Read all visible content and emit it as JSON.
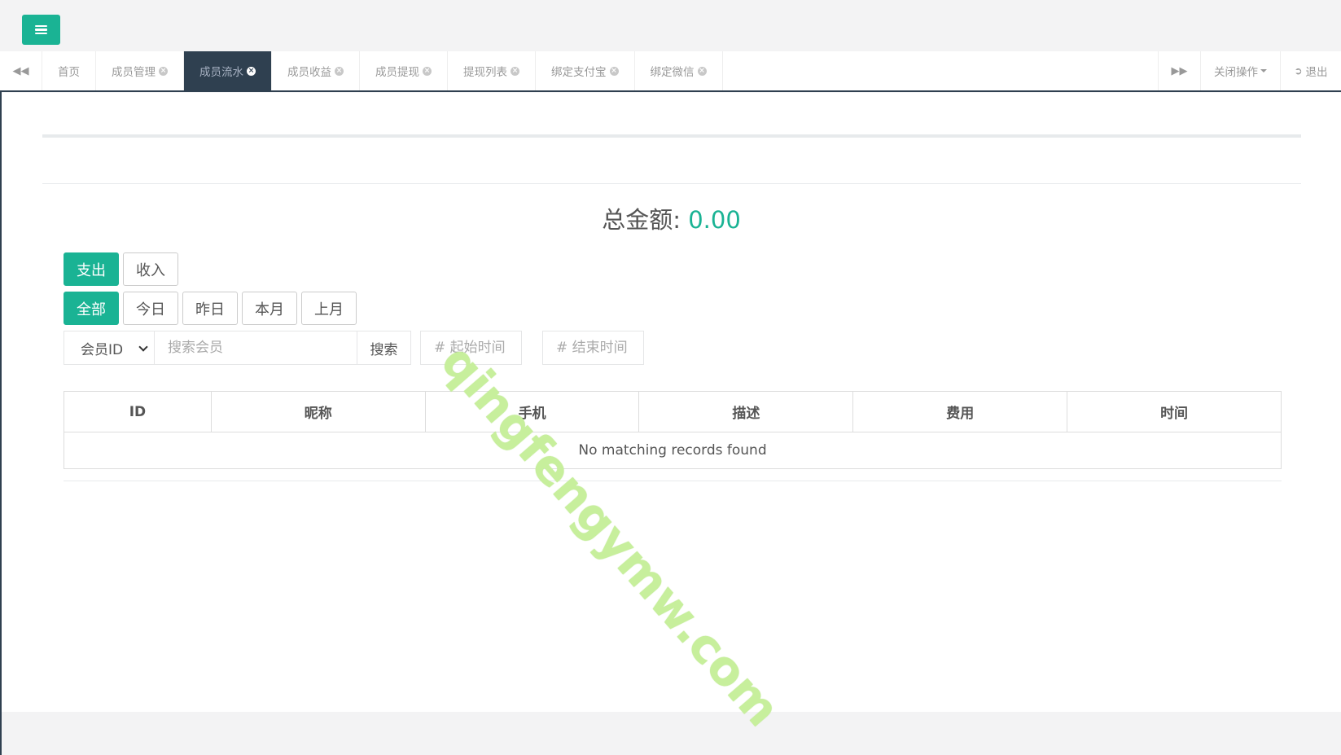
{
  "tabbar": {
    "tabs": [
      {
        "label": "首页",
        "closable": false,
        "active": false
      },
      {
        "label": "成员管理",
        "closable": true,
        "active": false
      },
      {
        "label": "成员流水",
        "closable": true,
        "active": true
      },
      {
        "label": "成员收益",
        "closable": true,
        "active": false
      },
      {
        "label": "成员提现",
        "closable": true,
        "active": false
      },
      {
        "label": "提现列表",
        "closable": true,
        "active": false
      },
      {
        "label": "绑定支付宝",
        "closable": true,
        "active": false
      },
      {
        "label": "绑定微信",
        "closable": true,
        "active": false
      }
    ],
    "close_ops_label": "关闭操作",
    "logout_label": "退出"
  },
  "summary": {
    "total_label": "总金额:",
    "total_value": "0.00"
  },
  "type_filter": {
    "options": [
      "支出",
      "收入"
    ],
    "active": "支出"
  },
  "period_filter": {
    "options": [
      "全部",
      "今日",
      "昨日",
      "本月",
      "上月"
    ],
    "active": "全部"
  },
  "search": {
    "field_select": "会员ID",
    "placeholder": "搜索会员",
    "button_label": "搜索",
    "start_placeholder": "# 起始时间",
    "end_placeholder": "# 结束时间"
  },
  "table": {
    "columns": [
      "ID",
      "昵称",
      "手机",
      "描述",
      "费用",
      "时间"
    ],
    "empty_message": "No matching records found"
  },
  "watermark": "qingfengymw.com",
  "colors": {
    "accent": "#1ab394",
    "nav_dark": "#2f4050"
  }
}
